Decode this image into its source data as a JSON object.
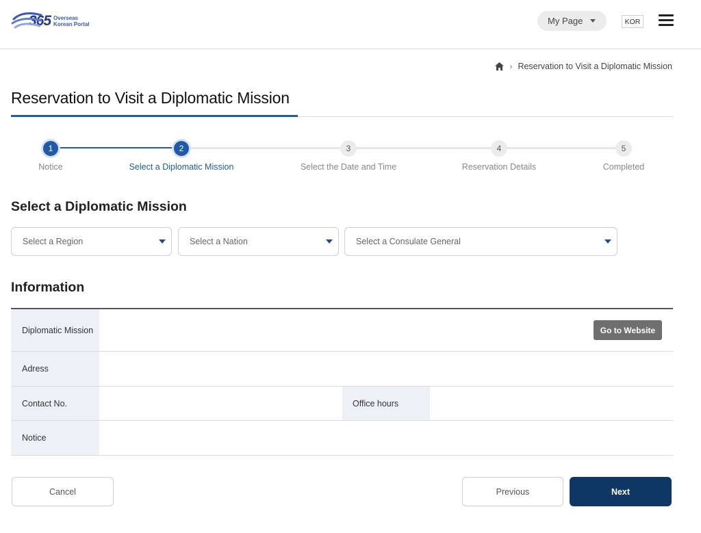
{
  "header": {
    "logo_number": "365",
    "logo_line1": "Overseas",
    "logo_line2": "Korean Portal",
    "mypage_label": "My Page",
    "language": "KOR"
  },
  "breadcrumb": {
    "current": "Reservation to Visit a Diplomatic Mission"
  },
  "page_title": "Reservation to Visit a Diplomatic Mission",
  "stepper": {
    "current_step": 2,
    "steps": [
      {
        "number": "1",
        "label": "Notice"
      },
      {
        "number": "2",
        "label": "Select a Diplomatic Mission"
      },
      {
        "number": "3",
        "label": "Select the Date and Time"
      },
      {
        "number": "4",
        "label": "Reservation Details"
      },
      {
        "number": "5",
        "label": "Completed"
      }
    ]
  },
  "select_section": {
    "title": "Select a Diplomatic Mission",
    "region_placeholder": "Select a Region",
    "nation_placeholder": "Select a Nation",
    "consulate_placeholder": "Select a Consulate General"
  },
  "info_section": {
    "title": "Information",
    "mission_label": "Diplomatic Mission",
    "website_button": "Go to Website",
    "address_label": "Adress",
    "contact_label": "Contact No.",
    "office_hours_label": "Office hours",
    "notice_label": "Notice"
  },
  "buttons": {
    "cancel": "Cancel",
    "previous": "Previous",
    "next": "Next"
  },
  "colors": {
    "primary": "#1f5aa6",
    "dark_button": "#0f3765",
    "table_header_bg": "#edf1f7"
  }
}
